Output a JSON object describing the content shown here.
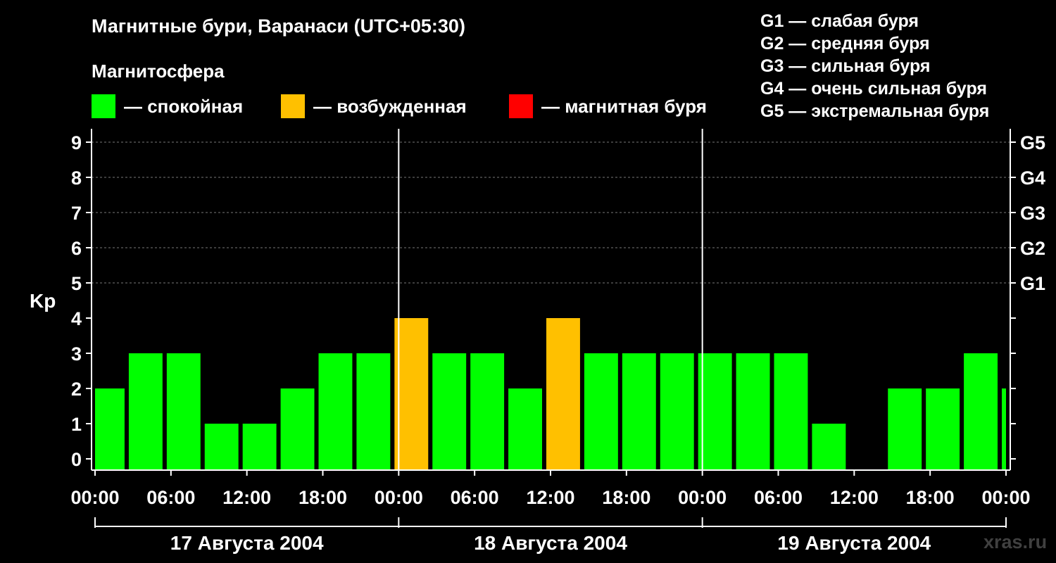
{
  "header": {
    "title": "Магнитные бури, Варанаси (UTC+05:30)",
    "subtitle": "Магнитосфера"
  },
  "legend": [
    {
      "color": "#00ff00",
      "label": "— спокойная"
    },
    {
      "color": "#ffc000",
      "label": "— возбужденная"
    },
    {
      "color": "#ff0000",
      "label": "— магнитная буря"
    }
  ],
  "storm_levels": [
    "G1 — слабая буря",
    "G2 — средняя буря",
    "G3 — сильная буря",
    "G4 — очень сильная буря",
    "G5 — экстремальная буря"
  ],
  "watermark": "xras.ru",
  "colors": {
    "quiet": "#00ff00",
    "active": "#ffc000",
    "storm": "#ff0000",
    "background": "#000000"
  },
  "chart_data": {
    "type": "bar",
    "ylabel": "Kp",
    "ylim": [
      0,
      9
    ],
    "yticks": [
      0,
      1,
      2,
      3,
      4,
      5,
      6,
      7,
      8,
      9
    ],
    "right_ticks": [
      {
        "value": 5,
        "label": "G1"
      },
      {
        "value": 6,
        "label": "G2"
      },
      {
        "value": 7,
        "label": "G3"
      },
      {
        "value": 8,
        "label": "G4"
      },
      {
        "value": 9,
        "label": "G5"
      }
    ],
    "grid": "dashed horizontal",
    "x_range_hours": [
      0,
      72
    ],
    "x_tick_labels": [
      "00:00",
      "06:00",
      "12:00",
      "18:00",
      "00:00",
      "06:00",
      "12:00",
      "18:00",
      "00:00",
      "06:00",
      "12:00",
      "18:00",
      "00:00"
    ],
    "days": [
      "17 Августа 2004",
      "18 Августа 2004",
      "19 Августа 2004"
    ],
    "bars": [
      {
        "start": 0,
        "end": 2.5,
        "kp": 2,
        "level": "quiet"
      },
      {
        "start": 2.5,
        "end": 5.5,
        "kp": 3,
        "level": "quiet"
      },
      {
        "start": 5.5,
        "end": 8.5,
        "kp": 3,
        "level": "quiet"
      },
      {
        "start": 8.5,
        "end": 11.5,
        "kp": 1,
        "level": "quiet"
      },
      {
        "start": 11.5,
        "end": 14.5,
        "kp": 1,
        "level": "quiet"
      },
      {
        "start": 14.5,
        "end": 17.5,
        "kp": 2,
        "level": "quiet"
      },
      {
        "start": 17.5,
        "end": 20.5,
        "kp": 3,
        "level": "quiet"
      },
      {
        "start": 20.5,
        "end": 23.5,
        "kp": 3,
        "level": "quiet"
      },
      {
        "start": 23.5,
        "end": 26.5,
        "kp": 4,
        "level": "active"
      },
      {
        "start": 26.5,
        "end": 29.5,
        "kp": 3,
        "level": "quiet"
      },
      {
        "start": 29.5,
        "end": 32.5,
        "kp": 3,
        "level": "quiet"
      },
      {
        "start": 32.5,
        "end": 35.5,
        "kp": 2,
        "level": "quiet"
      },
      {
        "start": 35.5,
        "end": 38.5,
        "kp": 4,
        "level": "active"
      },
      {
        "start": 38.5,
        "end": 41.5,
        "kp": 3,
        "level": "quiet"
      },
      {
        "start": 41.5,
        "end": 44.5,
        "kp": 3,
        "level": "quiet"
      },
      {
        "start": 44.5,
        "end": 47.5,
        "kp": 3,
        "level": "quiet"
      },
      {
        "start": 47.5,
        "end": 50.5,
        "kp": 3,
        "level": "quiet"
      },
      {
        "start": 50.5,
        "end": 53.5,
        "kp": 3,
        "level": "quiet"
      },
      {
        "start": 53.5,
        "end": 56.5,
        "kp": 3,
        "level": "quiet"
      },
      {
        "start": 56.5,
        "end": 59.5,
        "kp": 1,
        "level": "quiet"
      },
      {
        "start": 59.5,
        "end": 62.5,
        "kp": 0,
        "level": "quiet"
      },
      {
        "start": 62.5,
        "end": 65.5,
        "kp": 2,
        "level": "quiet"
      },
      {
        "start": 65.5,
        "end": 68.5,
        "kp": 2,
        "level": "quiet"
      },
      {
        "start": 68.5,
        "end": 71.5,
        "kp": 3,
        "level": "quiet"
      },
      {
        "start": 71.5,
        "end": 72,
        "kp": 2,
        "level": "quiet"
      }
    ]
  }
}
